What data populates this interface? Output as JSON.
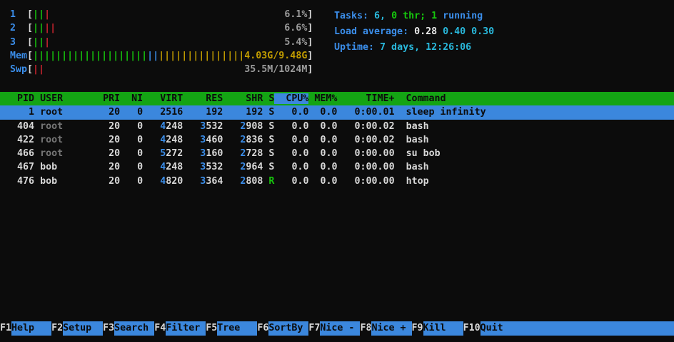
{
  "colors": {
    "bg": "#0c0c0c",
    "fg": "#d8d8d8",
    "white": "#eaeaea",
    "gray": "#9b9b9b",
    "dim": "#767676",
    "black": "#0c0c0c",
    "blue": "#3b8eea",
    "bg_blue": "#3b87dd",
    "cyan": "#29b8db",
    "green": "#16c60c",
    "header_green": "#14a414",
    "red": "#d0252f",
    "yellow": "#c19c00"
  },
  "meters": {
    "label_width": 3,
    "interior_width": 48,
    "rows": [
      {
        "name": "cpu1",
        "label": "1",
        "bars": [
          [
            "green",
            2
          ],
          [
            "red",
            1
          ]
        ],
        "text": "6.1%",
        "text_color": "gray"
      },
      {
        "name": "cpu2",
        "label": "2",
        "bars": [
          [
            "green",
            2
          ],
          [
            "red",
            2
          ]
        ],
        "text": "6.6%",
        "text_color": "gray"
      },
      {
        "name": "cpu3",
        "label": "3",
        "bars": [
          [
            "green",
            2
          ],
          [
            "red",
            1
          ]
        ],
        "text": "5.4%",
        "text_color": "gray"
      },
      {
        "name": "mem",
        "label": "Mem",
        "bars": [
          [
            "green",
            20
          ],
          [
            "blue",
            2
          ],
          [
            "yellow",
            15
          ]
        ],
        "text": "4.03G/9.48G",
        "text_color": "yellow"
      },
      {
        "name": "swp",
        "label": "Swp",
        "bars": [
          [
            "red",
            2
          ]
        ],
        "text": "35.5M/1024M",
        "text_color": "gray"
      }
    ]
  },
  "info": {
    "lines": [
      {
        "name": "tasks-summary",
        "segments": [
          [
            "Tasks: ",
            "blue"
          ],
          [
            "6, ",
            "cyan"
          ],
          [
            "0 thr; ",
            "green"
          ],
          [
            "1 ",
            "green"
          ],
          [
            "running",
            "blue"
          ]
        ]
      },
      {
        "name": "load-average",
        "segments": [
          [
            "Load average: ",
            "blue"
          ],
          [
            "0.28 ",
            "white"
          ],
          [
            "0.40 ",
            "cyan"
          ],
          [
            "0.30",
            "cyan"
          ]
        ]
      },
      {
        "name": "uptime",
        "segments": [
          [
            "Uptime: ",
            "blue"
          ],
          [
            "7 days, 12:26:06",
            "cyan"
          ]
        ]
      }
    ]
  },
  "table": {
    "sort_column": "cpu",
    "columns": [
      {
        "id": "pid",
        "label": "PID",
        "width": 6,
        "align": "right"
      },
      {
        "id": "user",
        "label": "USER",
        "width": 9,
        "align": "left",
        "pre": " "
      },
      {
        "id": "pri",
        "label": "PRI",
        "width": 5,
        "align": "right"
      },
      {
        "id": "ni",
        "label": "NI",
        "width": 4,
        "align": "right"
      },
      {
        "id": "virt",
        "label": "VIRT",
        "width": 7,
        "align": "right"
      },
      {
        "id": "res",
        "label": "RES",
        "width": 7,
        "align": "right"
      },
      {
        "id": "shr",
        "label": "SHR",
        "width": 7,
        "align": "right"
      },
      {
        "id": "s",
        "label": "S",
        "width": 2,
        "align": "right"
      },
      {
        "id": "cpu",
        "label": "CPU%",
        "width": 6,
        "align": "right"
      },
      {
        "id": "mem",
        "label": "MEM%",
        "width": 5,
        "align": "right"
      },
      {
        "id": "time",
        "label": "TIME+",
        "width": 10,
        "align": "right"
      },
      {
        "id": "cmd",
        "label": "Command",
        "width": 47,
        "align": "left",
        "pre": "  "
      }
    ],
    "rows": [
      {
        "selected": true,
        "pid": "1",
        "user": "root",
        "user_color": "fg",
        "pri": "20",
        "ni": "0",
        "virt": "2516",
        "res": "192",
        "shr": "192",
        "s": "S",
        "s_color": "fg",
        "cpu": "0.0",
        "mem": "0.0",
        "time": "0:00.01",
        "cmd": "sleep infinity"
      },
      {
        "selected": false,
        "pid": "404",
        "user": "root",
        "user_color": "dim",
        "pri": "20",
        "ni": "0",
        "virt": [
          "4",
          "248"
        ],
        "res": [
          "3",
          "532"
        ],
        "shr": [
          "2",
          "908"
        ],
        "s": "S",
        "s_color": "fg",
        "cpu": "0.0",
        "mem": "0.0",
        "time": "0:00.02",
        "cmd": "bash"
      },
      {
        "selected": false,
        "pid": "422",
        "user": "root",
        "user_color": "dim",
        "pri": "20",
        "ni": "0",
        "virt": [
          "4",
          "248"
        ],
        "res": [
          "3",
          "460"
        ],
        "shr": [
          "2",
          "836"
        ],
        "s": "S",
        "s_color": "fg",
        "cpu": "0.0",
        "mem": "0.0",
        "time": "0:00.02",
        "cmd": "bash"
      },
      {
        "selected": false,
        "pid": "466",
        "user": "root",
        "user_color": "dim",
        "pri": "20",
        "ni": "0",
        "virt": [
          "5",
          "272"
        ],
        "res": [
          "3",
          "160"
        ],
        "shr": [
          "2",
          "728"
        ],
        "s": "S",
        "s_color": "fg",
        "cpu": "0.0",
        "mem": "0.0",
        "time": "0:00.00",
        "cmd": "su bob"
      },
      {
        "selected": false,
        "pid": "467",
        "user": "bob",
        "user_color": "fg",
        "pri": "20",
        "ni": "0",
        "virt": [
          "4",
          "248"
        ],
        "res": [
          "3",
          "532"
        ],
        "shr": [
          "2",
          "964"
        ],
        "s": "S",
        "s_color": "fg",
        "cpu": "0.0",
        "mem": "0.0",
        "time": "0:00.00",
        "cmd": "bash"
      },
      {
        "selected": false,
        "pid": "476",
        "user": "bob",
        "user_color": "fg",
        "pri": "20",
        "ni": "0",
        "virt": [
          "4",
          "820"
        ],
        "res": [
          "3",
          "364"
        ],
        "shr": [
          "2",
          "808"
        ],
        "s": "R",
        "s_color": "green",
        "cpu": "0.0",
        "mem": "0.0",
        "time": "0:00.00",
        "cmd": "htop"
      }
    ]
  },
  "fkeys": {
    "label_width": 7,
    "items": [
      {
        "key": "F1",
        "label": "Help"
      },
      {
        "key": "F2",
        "label": "Setup"
      },
      {
        "key": "F3",
        "label": "Search"
      },
      {
        "key": "F4",
        "label": "Filter"
      },
      {
        "key": "F5",
        "label": "Tree"
      },
      {
        "key": "F6",
        "label": "SortBy"
      },
      {
        "key": "F7",
        "label": "Nice -"
      },
      {
        "key": "F8",
        "label": "Nice +"
      },
      {
        "key": "F9",
        "label": "Kill"
      },
      {
        "key": "F10",
        "label": "Quit"
      }
    ]
  }
}
